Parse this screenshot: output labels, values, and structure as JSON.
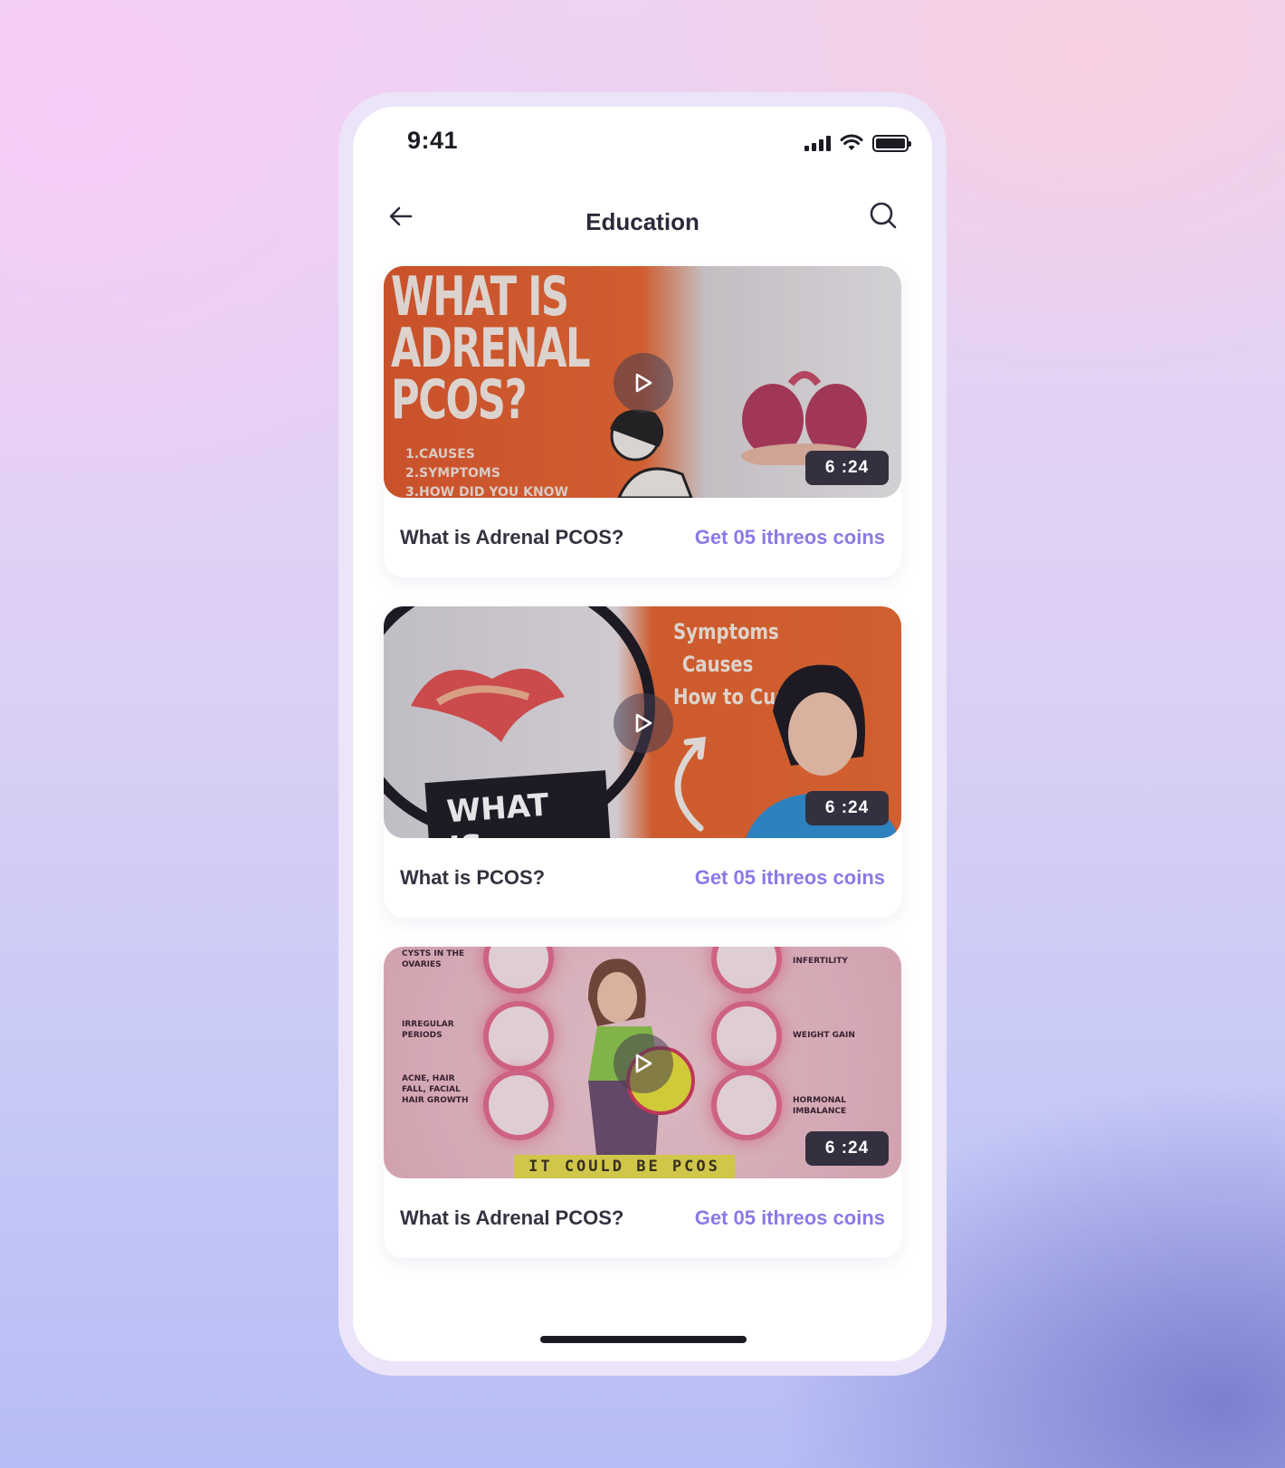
{
  "status_bar": {
    "time": "9:41",
    "signal_icon": "cellular-signal-icon",
    "wifi_icon": "wifi-icon",
    "battery_icon": "battery-icon"
  },
  "header": {
    "title": "Education",
    "back_icon": "arrow-left-icon",
    "search_icon": "search-icon"
  },
  "videos": [
    {
      "title": "What is Adrenal PCOS?",
      "reward": "Get 05 ithreos coins",
      "duration": "6 :24",
      "thumbnail": {
        "headline": "WHAT IS ADRENAL PCOS?",
        "list": [
          "1.CAUSES",
          "2.SYMPTOMS",
          "3.HOW DID YOU KNOW"
        ]
      }
    },
    {
      "title": "What is PCOS?",
      "reward": "Get 05 ithreos coins",
      "duration": "6 :24",
      "thumbnail": {
        "lines": [
          "Symptoms",
          "Causes",
          "How to Cure"
        ],
        "box_text": "WHAT IS PCOS?"
      }
    },
    {
      "title": "What is Adrenal PCOS?",
      "reward": "Get 05 ithreos coins",
      "duration": "6 :24",
      "thumbnail": {
        "left_labels": [
          "CYSTS IN THE OVARIES",
          "IRREGULAR PERIODS",
          "ACNE, HAIR FALL, FACIAL HAIR GROWTH"
        ],
        "right_labels": [
          "INFERTILITY",
          "WEIGHT GAIN",
          "HORMONAL IMBALANCE"
        ],
        "banner": "IT COULD BE PCOS"
      }
    }
  ],
  "colors": {
    "accent": "#8b79e6",
    "text_dark": "#34323f",
    "badge_bg": "#34303f"
  }
}
